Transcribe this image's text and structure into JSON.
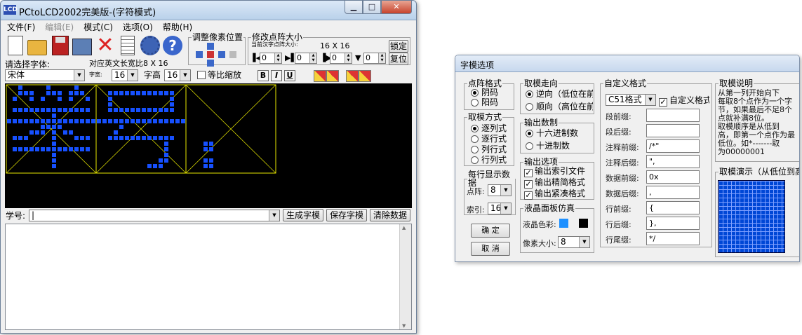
{
  "main": {
    "title": "PCtoLCD2002完美版-(字符模式)",
    "app_icon": "LCD",
    "caption": {
      "minimize": "▁",
      "maximize": "□",
      "close": "✕"
    },
    "menu": [
      "文件(F)",
      "编辑(E)",
      "模式(C)",
      "选项(O)",
      "帮助(H)"
    ],
    "pixel_group_label": "调整像素位置",
    "size_group_label": "修改点阵大小",
    "current_size_small": "当前汉字点阵大小:",
    "current_size": "16 X 16",
    "lock_button": "锁定",
    "reset_button": "复位",
    "spin_values": [
      "0",
      "0",
      "0",
      "0"
    ],
    "font_label": "请选择字体:",
    "ratio_label": "对应英文长宽比8 X 16",
    "font_value": "宋体",
    "width_small_label": "字宽:",
    "width_value": "16",
    "height_label": "字高",
    "height_value": "16",
    "scale_label": "等比缩放",
    "fmt_buttons": [
      "B",
      "I",
      "U"
    ],
    "input_label": "学号:",
    "generate_button": "生成字模",
    "save_button": "保存字模",
    "clear_button": "清除数据"
  },
  "canvas": {
    "pixel_color": "#1650ff",
    "frame_color": "#e8e800",
    "glyph_count": 3
  },
  "dialog": {
    "title": "字模选项",
    "dot_format": {
      "label": "点阵格式",
      "options": [
        "阴码",
        "阳码"
      ],
      "selected": 0
    },
    "take_mode": {
      "label": "取模方式",
      "options": [
        "逐列式",
        "逐行式",
        "列行式",
        "行列式"
      ],
      "selected": 0
    },
    "per_line": {
      "label": "每行显示数据",
      "dot_label": "点阵:",
      "dot_value": "8",
      "index_label": "索引:",
      "index_value": "16"
    },
    "ok_button": "确 定",
    "cancel_button": "取 消",
    "direction": {
      "label": "取模走向",
      "options": [
        "逆向（低位在前）",
        "顺向（高位在前）"
      ],
      "selected": 0
    },
    "num_format": {
      "label": "输出数制",
      "options": [
        "十六进制数",
        "十进制数"
      ],
      "selected": 0
    },
    "output": {
      "label": "输出选项",
      "options": [
        "输出索引文件",
        "输出精简格式",
        "输出紧凑格式"
      ]
    },
    "lcd_sim": {
      "label": "液晶面板仿真",
      "color_label": "液晶色彩:",
      "fg_color": "#1e90ff",
      "bg_color": "#000000",
      "pixel_label": "像素大小:",
      "pixel_value": "8"
    },
    "custom": {
      "label": "自定义格式",
      "format_value": "C51格式",
      "custom_check": "自定义格式",
      "fields": [
        {
          "label": "段前缀:",
          "value": ""
        },
        {
          "label": "段后缀:",
          "value": ""
        },
        {
          "label": "注释前缀:",
          "value": "/*\""
        },
        {
          "label": "注释后缀:",
          "value": "\","
        },
        {
          "label": "数据前缀:",
          "value": "0x"
        },
        {
          "label": "数据后缀:",
          "value": ","
        },
        {
          "label": "行前缀:",
          "value": "{"
        },
        {
          "label": "行后缀:",
          "value": "},"
        },
        {
          "label": "行尾缀:",
          "value": "*/"
        }
      ]
    },
    "explain": {
      "label": "取模说明",
      "lines": [
        "从第一列开始向下",
        "每取8个点作为一个字",
        "节，如果最后不足8个",
        "点就补满8位。",
        "取模顺序是从低到",
        "高，即第一个点作为最",
        "低位。如*-------取",
        "为00000001"
      ]
    },
    "demo_label": "取模演示（从低位到高位）"
  }
}
